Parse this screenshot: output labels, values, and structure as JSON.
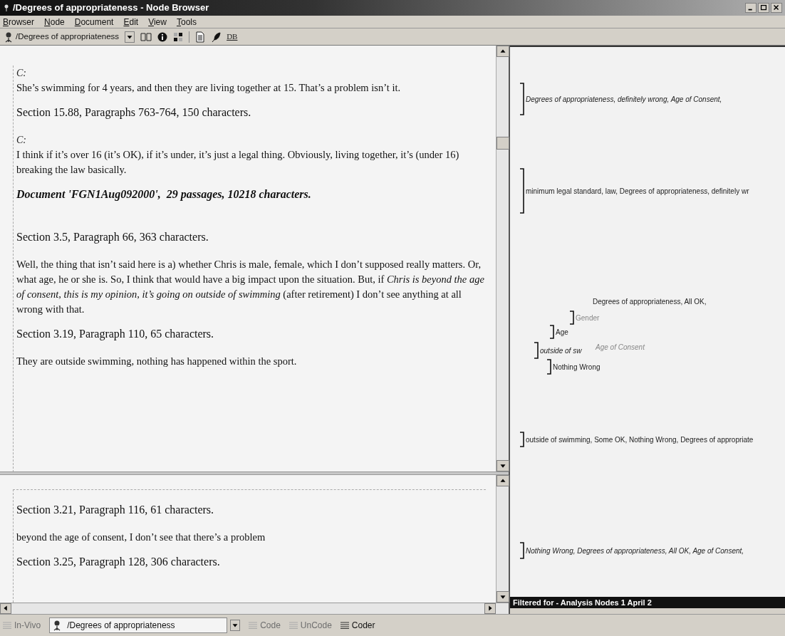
{
  "window": {
    "title": "/Degrees of appropriateness - Node Browser"
  },
  "menu": [
    {
      "label": "Browser"
    },
    {
      "label": "Node"
    },
    {
      "label": "Document"
    },
    {
      "label": "Edit"
    },
    {
      "label": "View"
    },
    {
      "label": "Tools"
    }
  ],
  "toolbar": {
    "node_selector": "/Degrees of appropriateness",
    "db_button": "DB"
  },
  "upper_pane": {
    "items": [
      {
        "kind": "speaker",
        "text": "C:"
      },
      {
        "kind": "passage",
        "text": "She’s swimming for 4 years, and then they are living together at 15. That’s a problem isn’t it."
      },
      {
        "kind": "section",
        "text": "Section 15.88, Paragraphs 763-764, 150 characters."
      },
      {
        "kind": "speaker",
        "text": "C:"
      },
      {
        "kind": "passage",
        "text": "I think if it’s over 16 (it’s OK), if it’s under, it’s just a legal thing. Obviously, living together, it’s (under 16) breaking the law basically."
      },
      {
        "kind": "document",
        "text": "Document 'FGN1Aug092000',  29 passages, 10218 characters."
      },
      {
        "kind": "section",
        "text": "Section 3.5, Paragraph 66, 363 characters."
      },
      {
        "kind": "passage",
        "text": "Well, the thing that isn’t said here is a) whether Chris is male, female, which I don’t supposed really matters. Or, what age, he or she is. So, I think that would have a big impact upon the situation. But, if *Chris is beyond the age of consent, this is my opinion, it’s going on outside of swimming* (after retirement) I don’t see anything at all wrong with that."
      },
      {
        "kind": "section",
        "text": "Section 3.19, Paragraph 110, 65 characters."
      },
      {
        "kind": "passage",
        "text": "They are outside swimming, nothing has happened within the sport."
      }
    ]
  },
  "lower_pane": {
    "items": [
      {
        "kind": "section",
        "text": "Section 3.21, Paragraph 116, 61 characters."
      },
      {
        "kind": "passage",
        "text": "beyond the age of consent, I don’t see that there’s a problem"
      },
      {
        "kind": "section",
        "text": "Section 3.25, Paragraph 128, 306 characters."
      }
    ]
  },
  "coding_stripes": [
    {
      "kind": "single",
      "italic": true,
      "label": "Degrees of appropriateness, definitely wrong, Age of Consent,"
    },
    {
      "kind": "single",
      "italic": false,
      "label": "minimum legal standard, law, Degrees of appropriateness, definitely wr"
    },
    {
      "kind": "cluster",
      "labels": [
        {
          "text": "Degrees of appropriateness, All OK,",
          "italic": false,
          "dim": false
        },
        {
          "text": "Gender",
          "italic": false,
          "dim": true
        },
        {
          "text": "Age",
          "italic": false,
          "dim": false
        },
        {
          "text": "outside of sw",
          "italic": true,
          "dim": false
        },
        {
          "text": "Age of Consent",
          "italic": true,
          "dim": true
        },
        {
          "text": "Nothing Wrong",
          "italic": false,
          "dim": false
        }
      ]
    },
    {
      "kind": "single",
      "italic": false,
      "label": "outside of swimming, Some OK, Nothing Wrong, Degrees of appropriate"
    },
    {
      "kind": "single",
      "italic": true,
      "label": "Nothing Wrong, Degrees of appropriateness, All OK, Age of Consent,"
    }
  ],
  "filter_bar": "Filtered for - Analysis Nodes 1 April 2",
  "bottom_toolbar": {
    "buttons": [
      {
        "label": "In-Vivo",
        "disabled": true
      },
      {
        "label": "Code",
        "disabled": true
      },
      {
        "label": "UnCode",
        "disabled": true
      },
      {
        "label": "Coder",
        "disabled": false
      }
    ],
    "node_selector": "/Degrees of appropriateness"
  }
}
